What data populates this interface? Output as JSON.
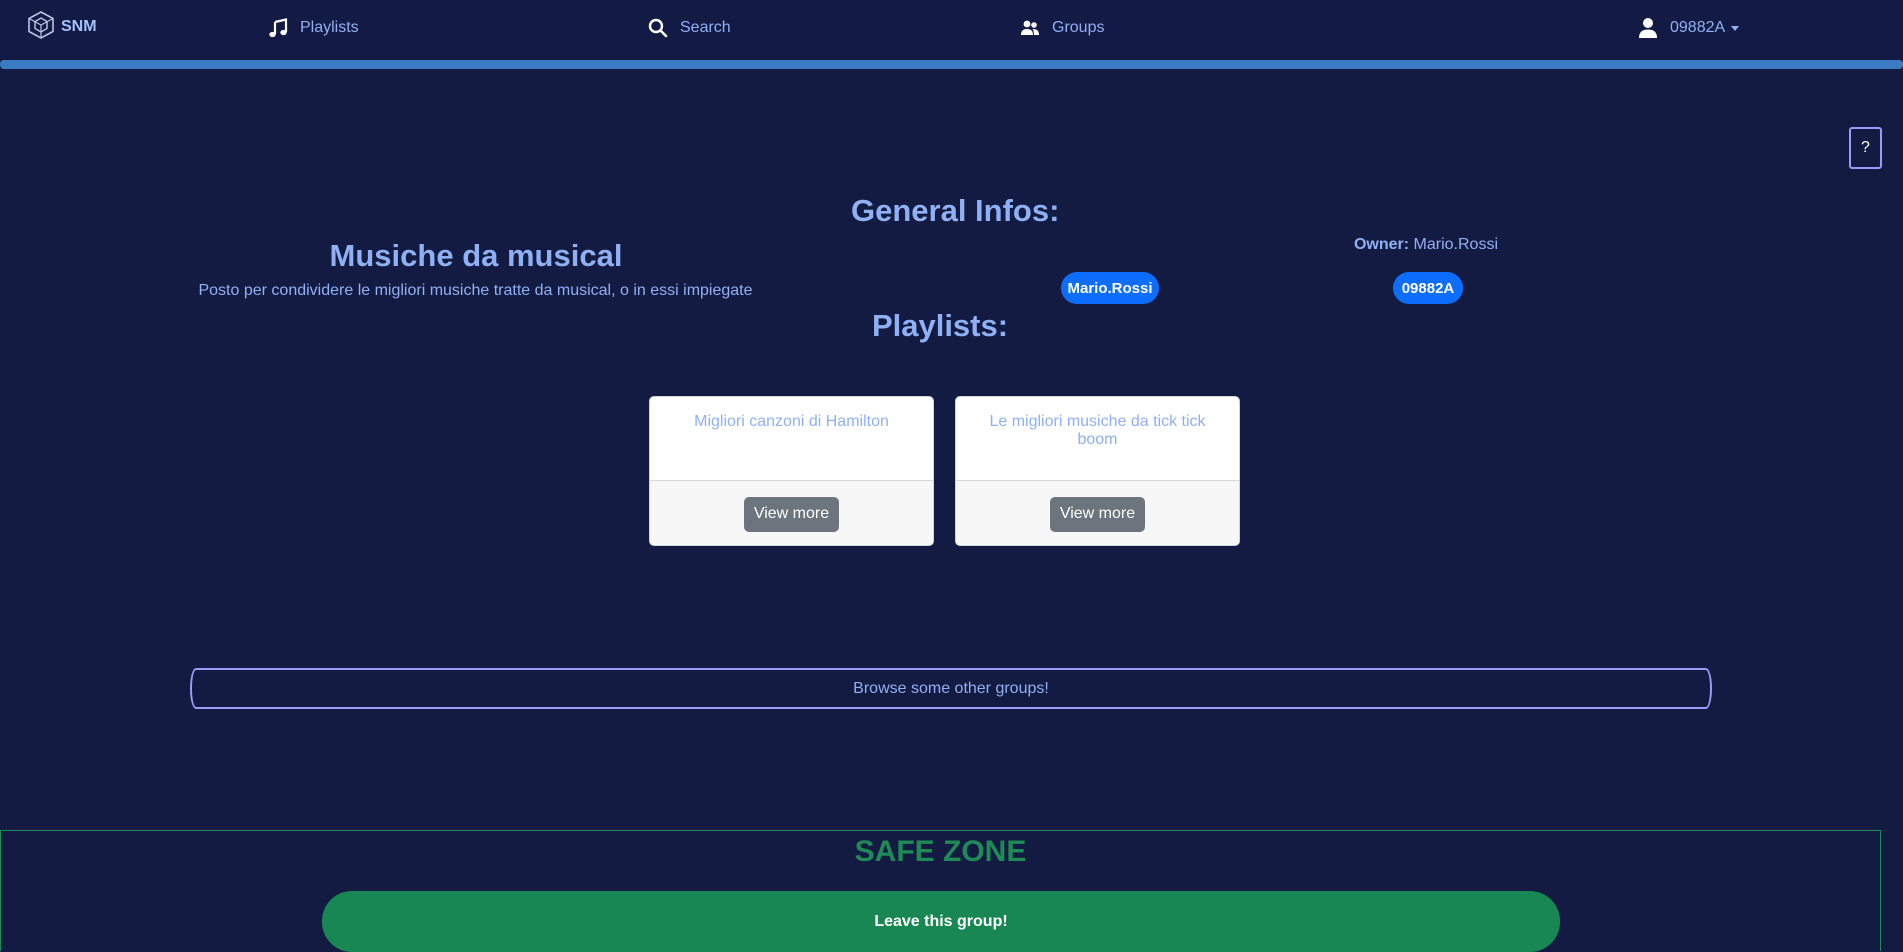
{
  "navbar": {
    "brand": "SNM",
    "links": {
      "playlists": "Playlists",
      "search": "Search",
      "groups": "Groups"
    },
    "user": "09882A"
  },
  "help": {
    "label": "?"
  },
  "group": {
    "general_title": "General Infos:",
    "name": "Musiche da musical",
    "description": "Posto per condividere le migliori musiche tratte da musical, o in essi impiegate",
    "owner_label": "Owner:",
    "owner": "Mario.Rossi",
    "members": [
      "Mario.Rossi",
      "09882A"
    ],
    "playlists_title": "Playlists:"
  },
  "playlists": [
    {
      "title": "Migliori canzoni di Hamilton",
      "button": "View more"
    },
    {
      "title": "Le migliori musiche da tick tick boom",
      "button": "View more"
    }
  ],
  "browse": {
    "label": "Browse some other groups!"
  },
  "safe_zone": {
    "title": "SAFE ZONE",
    "leave_label": "Leave this group!"
  },
  "colors": {
    "background": "#141b42",
    "accent_text": "#8fb0f4",
    "pill": "#0d6efd",
    "safe_green": "#198754",
    "outline": "#9a9af7",
    "top_bar": "#3b7bc4"
  }
}
